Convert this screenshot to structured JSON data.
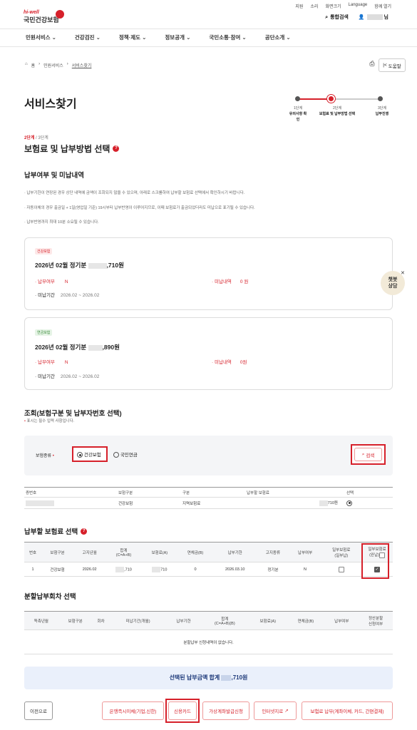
{
  "util": [
    "지원",
    "소리",
    "화면크기",
    "Language",
    "함께 열기"
  ],
  "logo": {
    "top": "hi-well",
    "name": "국민건강보험"
  },
  "header": {
    "search": "통합검색",
    "user_suffix": "님"
  },
  "gnb": [
    "민원서비스",
    "건강검진",
    "정책·제도",
    "정보공개",
    "국민소통·참여",
    "공단소개"
  ],
  "breadcrumb": [
    "홈",
    "민원서비스",
    "서비스찾기"
  ],
  "help": "도움말",
  "page_title": "서비스찾기",
  "steps": [
    {
      "no": "1단계",
      "label": "유의사항 확인"
    },
    {
      "no": "2단계",
      "label": "보험료 및 납부방법 선택"
    },
    {
      "no": "3단계",
      "label": "납부진행"
    }
  ],
  "step_indicator": {
    "current": "2단계",
    "total": " / 3단계"
  },
  "section_title": "보험료 및 납부방법 선택",
  "status": {
    "title": "납부여부 및 미납내역",
    "notes": [
      "납부기한이 연장된 경우 상단 내역에 금액이 조회되지 않을 수 있으며, 아래로 스크롤하여 납부할 보험료 선택에서 확인하시기 바랍니다.",
      "자동이체의 경우 출금일 + 1일(영업일 기준) 19시부터 납부반영이 이루어지므로, 이때 보험료가 출금되었더라도 미납으로 표기될 수 있습니다.",
      "납부반영까지 최대 10분 소요될 수 있습니다."
    ]
  },
  "cards": [
    {
      "badge": "건강보험",
      "title_pre": "2026년 02월 정기분",
      "title_post": ",710원",
      "paid_label": "납부여부",
      "paid": "N",
      "unpaid_label": "미납내역",
      "unpaid": "0 원",
      "period_label": "미납기간",
      "period": "2026.02 ~ 2026.02"
    },
    {
      "badge": "연금보험",
      "title_pre": "2026년 02월 정기분",
      "title_post": ",890원",
      "paid_label": "납부여부",
      "paid": "N",
      "unpaid_label": "미납내역",
      "unpaid": "0원",
      "period_label": "미납기간",
      "period": "2026.02 ~ 2026.02"
    }
  ],
  "chatbot": {
    "line1": "챗봇",
    "line2": "상담"
  },
  "inquiry": {
    "title": "조회(보험구분 및 납부자번호 선택)",
    "required_note": "표시는 필수 입력 사항입니다.",
    "field_label": "보험종류",
    "options": [
      "건강보험",
      "국민연금"
    ],
    "search_btn": "검색"
  },
  "result_table": {
    "headers": [
      "증번호",
      "보험구분",
      "구분",
      "납부할 보험료",
      "선택"
    ],
    "row": {
      "type": "건강보험",
      "kind": "지역보험료",
      "amount": "710원"
    }
  },
  "pay_select": {
    "title": "납부할 보험료 선택",
    "headers": [
      "번호",
      "보험구분",
      "고지년월",
      "합계\n(C=A+B)",
      "보험료(A)",
      "연체금(B)",
      "납부기한",
      "고지종류",
      "납부여부",
      "일부보험료\n(일부납)",
      "일부보험료\n(완납)"
    ],
    "row": {
      "no": "1",
      "type": "건강보험",
      "ym": "2026.02",
      "sum": ",710",
      "fee": "710",
      "late": "0",
      "due": "2026.03.10",
      "kind": "정기분",
      "paid": "N"
    }
  },
  "split": {
    "title": "분할납부회차 선택",
    "headers": [
      "독촉년월",
      "보험구분",
      "회차",
      "미납기간(개월)",
      "납부기한",
      "합계\n(C=A+B)(B)",
      "보험료(A)",
      "연체금(B)",
      "납부여부",
      "정산분할\n신청여부"
    ],
    "empty": "분할납부 신청내역이 없습니다."
  },
  "total": {
    "pre": "선택된 납부금액 합계",
    "post": ",710원"
  },
  "buttons": {
    "prev": "이전으로",
    "bank": "은행즉시이체(기업,신한)",
    "card": "신용카드",
    "virtual": "가상계좌발급신청",
    "giro": "인터넷지로",
    "etc": "보험료 납부(계좌이체, 카드, 간편결제)"
  }
}
